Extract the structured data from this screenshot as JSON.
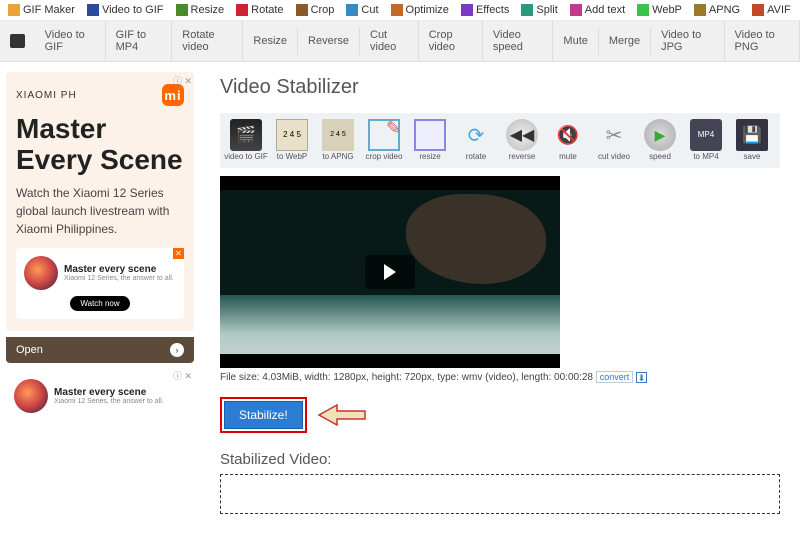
{
  "topnav": [
    {
      "label": "GIF Maker"
    },
    {
      "label": "Video to GIF"
    },
    {
      "label": "Resize"
    },
    {
      "label": "Rotate"
    },
    {
      "label": "Crop"
    },
    {
      "label": "Cut"
    },
    {
      "label": "Optimize"
    },
    {
      "label": "Effects"
    },
    {
      "label": "Split"
    },
    {
      "label": "Add text"
    },
    {
      "label": "WebP"
    },
    {
      "label": "APNG"
    },
    {
      "label": "AVIF"
    }
  ],
  "secondnav": [
    "Video to GIF",
    "GIF to MP4",
    "Rotate video",
    "Resize",
    "Reverse",
    "Cut video",
    "Crop video",
    "Video speed",
    "Mute",
    "Merge",
    "Video to JPG",
    "Video to PNG"
  ],
  "ad": {
    "brand": "XIAOMI PH",
    "heading": "Master Every Scene",
    "body": "Watch the Xiaomi 12 Series global launch livestream with Xiaomi Philippines.",
    "card_title": "Master every scene",
    "card_sub": "Xiaomi 12 Series, the answer to all.",
    "watch": "Watch now",
    "open": "Open",
    "close": "ⓘ ✕"
  },
  "page": {
    "title": "Video Stabilizer"
  },
  "toolbar": [
    {
      "label": "video to GIF"
    },
    {
      "label": "to WebP"
    },
    {
      "label": "to APNG"
    },
    {
      "label": "crop video"
    },
    {
      "label": "resize"
    },
    {
      "label": "rotate"
    },
    {
      "label": "reverse"
    },
    {
      "label": "mute"
    },
    {
      "label": "cut video"
    },
    {
      "label": "speed"
    },
    {
      "label": "to MP4"
    },
    {
      "label": "save"
    }
  ],
  "info": {
    "text": "File size: 4.03MiB, width: 1280px, height: 720px, type: wmv (video), length: 00:00:28",
    "convert": "convert",
    "dl": "⬇"
  },
  "buttons": {
    "stabilize": "Stabilize!"
  },
  "output": {
    "label": "Stabilized Video:"
  }
}
